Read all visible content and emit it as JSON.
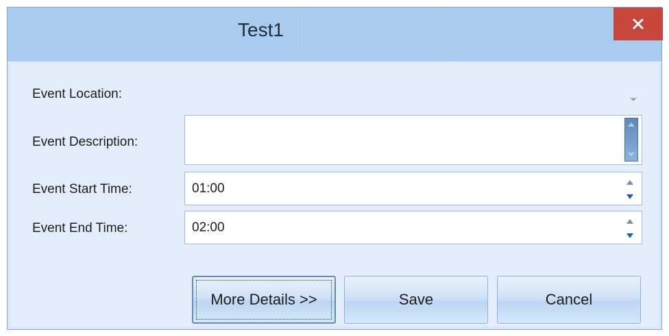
{
  "window": {
    "title": "Test1",
    "close_glyph": "close-icon"
  },
  "form": {
    "event_location_label": "Event Location:",
    "event_location_value": "",
    "event_description_label": "Event Description:",
    "event_description_value": "",
    "event_start_label": "Event Start Time:",
    "event_start_value": "01:00",
    "event_end_label": "Event End Time:",
    "event_end_value": "02:00"
  },
  "buttons": {
    "more_details": "More Details >>",
    "save": "Save",
    "cancel": "Cancel"
  },
  "colors": {
    "titlebar": "#a9cbef",
    "close": "#c8473c",
    "pane": "#e3edfb"
  }
}
